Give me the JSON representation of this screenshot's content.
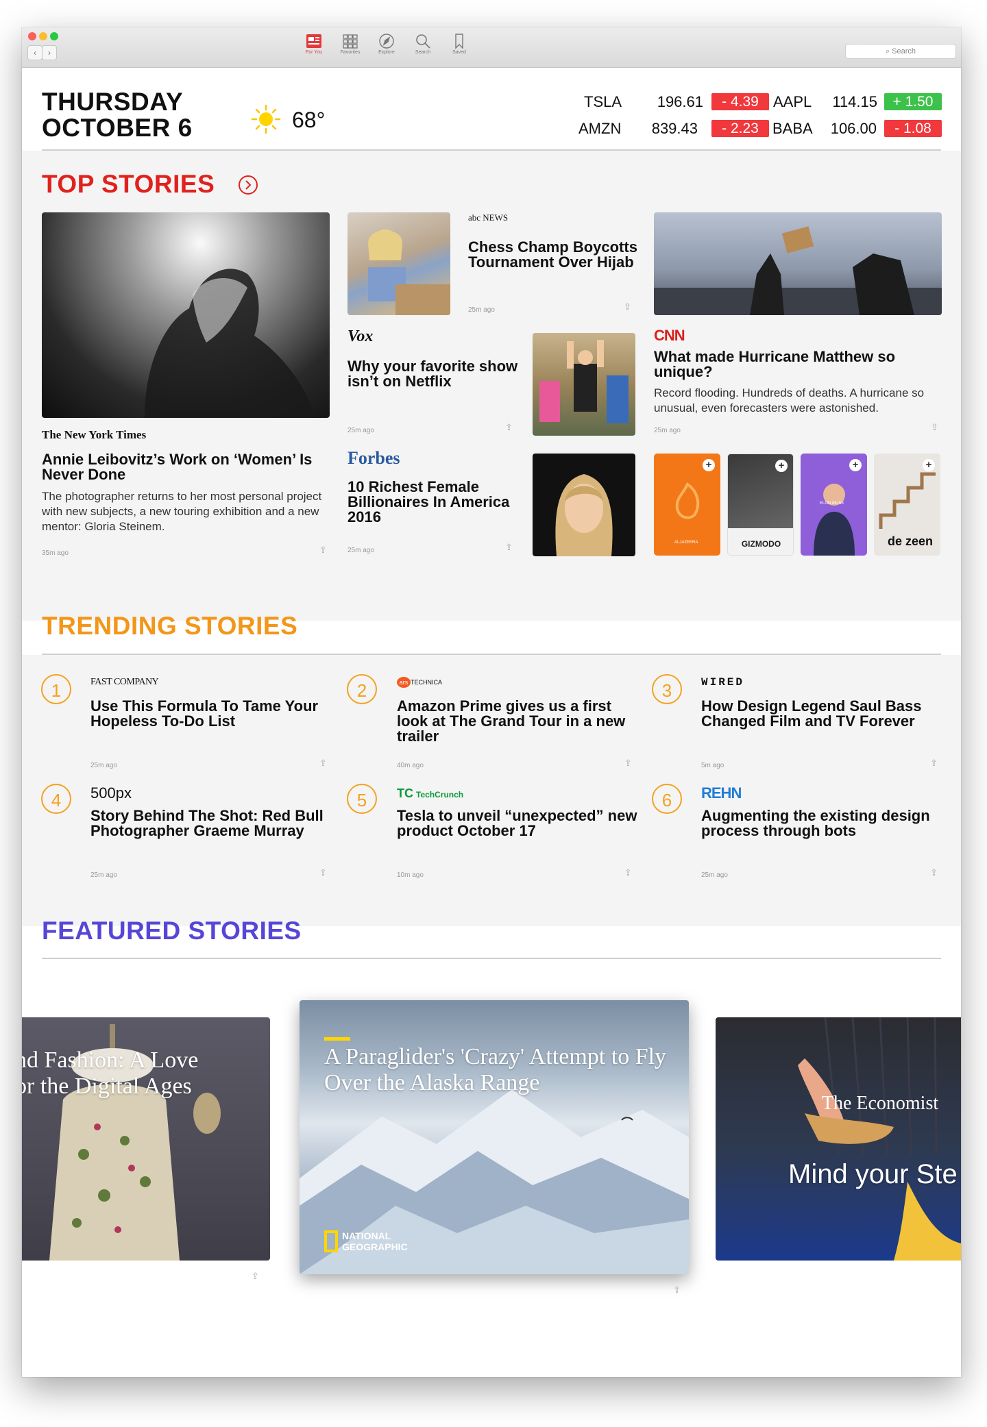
{
  "toolbar": {
    "tabs": [
      {
        "label": "For You",
        "icon": "for-you-icon"
      },
      {
        "label": "Favorites",
        "icon": "favorites-grid-icon"
      },
      {
        "label": "Explore",
        "icon": "compass-icon"
      },
      {
        "label": "Search",
        "icon": "magnifier-icon"
      },
      {
        "label": "Saved",
        "icon": "bookmark-icon"
      }
    ],
    "search_placeholder": "Search",
    "back": "‹",
    "forward": "›",
    "accent": "#e23a3a"
  },
  "header": {
    "day": "THURSDAY",
    "date": "OCTOBER 6",
    "temperature": "68°",
    "weather_icon": "sun-icon",
    "stocks": [
      {
        "symbol": "TSLA",
        "price": "196.61",
        "change": "- 4.39",
        "direction": "down"
      },
      {
        "symbol": "AAPL",
        "price": "114.15",
        "change": "+ 1.50",
        "direction": "up"
      },
      {
        "symbol": "AMZN",
        "price": "839.43",
        "change": "- 2.23",
        "direction": "down"
      },
      {
        "symbol": "BABA",
        "price": "106.00",
        "change": "- 1.08",
        "direction": "down"
      }
    ]
  },
  "top_stories": {
    "title": "TOP STORIES",
    "color": "#e0221d",
    "main": {
      "source": "The New York Times",
      "headline": "Annie Leibovitz’s Work on ‘Women’ Is Never Done",
      "description": "The photographer returns to her most personal project with new subjects, a new touring exhibition and a new mentor: Gloria Steinem.",
      "time": "35m ago"
    },
    "abc": {
      "source": "abc NEWS",
      "headline": "Chess Champ Boycotts Tournament Over Hijab",
      "time": "25m ago"
    },
    "vox": {
      "source": "Vox",
      "headline": "Why your favorite show isn’t on Netflix",
      "time": "25m ago"
    },
    "forbes": {
      "source": "Forbes",
      "headline": "10 Richest Female Billionaires In America 2016",
      "time": "25m ago"
    },
    "cnn": {
      "source": "CNN",
      "headline": "What made Hurricane Matthew so unique?",
      "description": "Record flooding. Hundreds of deaths. A hurricane so unusual, even forecasters were astonished.",
      "time": "25m ago"
    },
    "channels": [
      {
        "name": "ALJAZEERA"
      },
      {
        "name": "GIZMODO"
      },
      {
        "name": "ELON MUSK"
      },
      {
        "name": "de zeen"
      }
    ]
  },
  "trending": {
    "title": "TRENDING STORIES",
    "color": "#f39619",
    "items": [
      {
        "rank": "1",
        "source": "FAST COMPANY",
        "headline": "Use This Formula To Tame Your Hopeless To-Do List",
        "time": "25m ago"
      },
      {
        "rank": "2",
        "source": "TECHNICA",
        "source_badge": "ars",
        "headline": "Amazon Prime gives us a first look at The Grand Tour in a new trailer",
        "time": "40m ago"
      },
      {
        "rank": "3",
        "source": "WIRED",
        "headline": "How Design Legend Saul Bass Changed Film and TV Forever",
        "time": "5m ago"
      },
      {
        "rank": "4",
        "source": "500px",
        "headline": "Story Behind The Shot: Red Bull Photographer Graeme Murray",
        "time": "25m ago"
      },
      {
        "rank": "5",
        "source": "TechCrunch",
        "source_badge": "TC",
        "headline": "Tesla to unveil “unexpected” new product October 17",
        "time": "10m ago"
      },
      {
        "rank": "6",
        "source": "REHN",
        "headline": "Augmenting the existing design process through bots",
        "time": "25m ago"
      }
    ]
  },
  "featured": {
    "title": "FEATURED STORIES",
    "color": "#5646d8",
    "cards": [
      {
        "headline": "nd Fashion: A Love\nor the Digital Ages"
      },
      {
        "headline": "A Paraglider's 'Crazy' Attempt to Fly Over the Alaska Range",
        "source": "NATIONAL GEOGRAPHIC"
      },
      {
        "headline": "Mind your Ste",
        "source": "The Economist"
      }
    ]
  }
}
